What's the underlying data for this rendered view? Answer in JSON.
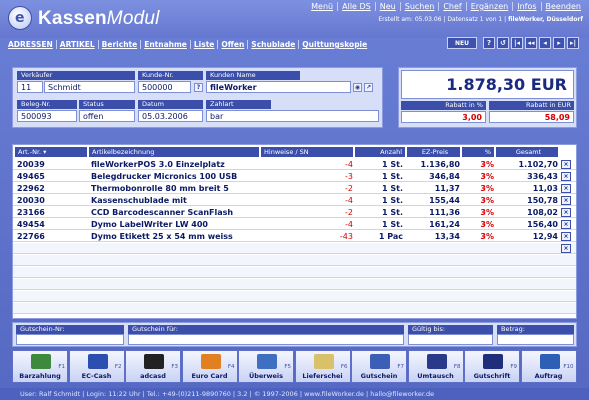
{
  "app": {
    "title_bold": "Kassen",
    "title_italic": "Modul",
    "logo_letter": "e"
  },
  "topmenu": [
    "Menü",
    "Alle DS",
    "Neu",
    "Suchen",
    "Chef",
    "Ergänzen",
    "Infos",
    "Beenden"
  ],
  "infoline": {
    "created": "Erstellt am: 05.03.06",
    "record": "Datensatz 1 von 1",
    "company": "fileWorker, Düsseldorf"
  },
  "mainnav": [
    "ADRESSEN",
    "ARTIKEL",
    "Berichte",
    "Entnahme",
    "Liste",
    "Offen",
    "Schublade",
    "Quittungskopie"
  ],
  "navright": {
    "neu": "NEU",
    "buttons": [
      "?",
      "↺",
      "|◂",
      "◂◂",
      "◂",
      "▸",
      "▸|"
    ]
  },
  "header": {
    "verkaeufer_label": "Verkäufer",
    "verkaeufer_id": "11",
    "verkaeufer_name": "Schmidt",
    "kunde_nr_label": "Kunde-Nr.",
    "kunde_nr": "500000",
    "help": "?",
    "kunden_name_label": "Kunden Name",
    "kunden_name": "fileWorker",
    "beleg_label": "Beleg-Nr.",
    "beleg": "500093",
    "status_label": "Status",
    "status": "offen",
    "datum_label": "Datum",
    "datum": "05.03.2006",
    "zahlart_label": "Zahlart",
    "zahlart": "bar"
  },
  "totals": {
    "total": "1.878,30 EUR",
    "rabatt_pct_label": "Rabatt in %",
    "rabatt_pct": "3,00",
    "rabatt_eur_label": "Rabatt in EUR",
    "rabatt_eur": "58,09"
  },
  "table": {
    "headers": [
      "Art.-Nr.",
      "Artikelbezeichnung",
      "Hinweise / SN",
      "Anzahl",
      "EZ-Preis",
      "%",
      "Gesamt"
    ],
    "rows": [
      {
        "nr": "20039",
        "desc": "fileWorkerPOS 3.0 Einzelplatz",
        "hint": "-4",
        "qty": "1 St.",
        "price": "1.136,80",
        "pct": "3%",
        "total": "1.102,70"
      },
      {
        "nr": "49465",
        "desc": "Belegdrucker Micronics 100 USB",
        "hint": "-3",
        "qty": "1 St.",
        "price": "346,84",
        "pct": "3%",
        "total": "336,43"
      },
      {
        "nr": "22962",
        "desc": "Thermobonrolle 80 mm breit 5",
        "hint": "-2",
        "qty": "1 St.",
        "price": "11,37",
        "pct": "3%",
        "total": "11,03"
      },
      {
        "nr": "20030",
        "desc": "Kassenschublade mit",
        "hint": "-4",
        "qty": "1 St.",
        "price": "155,44",
        "pct": "3%",
        "total": "150,78"
      },
      {
        "nr": "23166",
        "desc": "CCD Barcodescanner ScanFlash",
        "hint": "-2",
        "qty": "1 St.",
        "price": "111,36",
        "pct": "3%",
        "total": "108,02"
      },
      {
        "nr": "49454",
        "desc": "Dymo LabelWriter LW 400",
        "hint": "-4",
        "qty": "1 St.",
        "price": "161,24",
        "pct": "3%",
        "total": "156,40"
      },
      {
        "nr": "22766",
        "desc": "Dymo Etikett 25 x 54 mm weiss",
        "hint": "-43",
        "qty": "1 Pac",
        "price": "13,34",
        "pct": "3%",
        "total": "12,94"
      }
    ],
    "remove_symbol": "×"
  },
  "voucher": {
    "nr_label": "Gutschein-Nr:",
    "fuer_label": "Gutschein für:",
    "gueltig_label": "Gültig bis:",
    "betrag_label": "Betrag:"
  },
  "fkeys": [
    {
      "label": "Barzahlung",
      "key": "F1",
      "icon": "cash-icon",
      "color": "#3d8a3d"
    },
    {
      "label": "EC-Cash",
      "key": "F2",
      "icon": "ec-card-icon",
      "color": "#2a4fb0"
    },
    {
      "label": "adcasd",
      "key": "F3",
      "icon": "payment-card-icon",
      "color": "#222222"
    },
    {
      "label": "Euro Card",
      "key": "F4",
      "icon": "mastercard-icon",
      "color": "#e08020"
    },
    {
      "label": "Überweis",
      "key": "F5",
      "icon": "transfer-icon",
      "color": "#3e6fc0"
    },
    {
      "label": "Lieferschei",
      "key": "F6",
      "icon": "folder-icon",
      "color": "#d9c16a"
    },
    {
      "label": "Gutschein",
      "key": "F7",
      "icon": "gift-icon",
      "color": "#3b5fb7"
    },
    {
      "label": "Umtausch",
      "key": "F8",
      "icon": "exchange-icon",
      "color": "#2a3a8a"
    },
    {
      "label": "Gutschrift",
      "key": "F9",
      "icon": "credit-x-icon",
      "color": "#1f2d7a"
    },
    {
      "label": "Auftrag",
      "key": "F10",
      "icon": "order-icon",
      "color": "#2d5fb5"
    }
  ],
  "statusbar": "User: Ralf Schmidt | Login: 11:22 Uhr | Tel.: +49-(0)211-9890760 | 3.2 | © 1997-2006 | www.fileWorker.de | hallo@fileworker.de"
}
